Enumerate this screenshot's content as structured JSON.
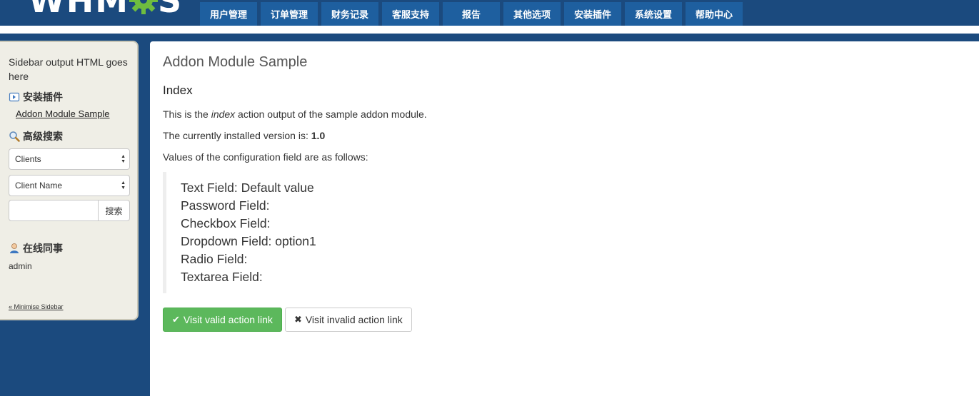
{
  "header": {
    "logo_left": "WHM",
    "logo_right": "S",
    "nav": [
      "用户管理",
      "订单管理",
      "财务记录",
      "客服支持",
      "报告",
      "其他选项",
      "安装插件",
      "系统设置",
      "帮助中心"
    ]
  },
  "sidebar": {
    "intro": "Sidebar output HTML goes here",
    "addons_heading": "安装插件",
    "addon_link": "Addon Module Sample",
    "search_heading": "高级搜索",
    "search_type": "Clients",
    "search_field": "Client Name",
    "search_value": "",
    "search_button": "搜索",
    "staff_heading": "在线同事",
    "staff_name": "admin",
    "minimise": "« Minimise Sidebar"
  },
  "content": {
    "title": "Addon Module Sample",
    "section": "Index",
    "para1_pre": "This is the ",
    "para1_em": "index",
    "para1_post": " action output of the sample addon module.",
    "para2_pre": "The currently installed version is: ",
    "para2_version": "1.0",
    "para3": "Values of the configuration field are as follows:",
    "fields": [
      "Text Field: Default value",
      "Password Field:",
      "Checkbox Field:",
      "Dropdown Field: option1",
      "Radio Field:",
      "Textarea Field:"
    ],
    "valid_button": "Visit valid action link",
    "invalid_button": "Visit invalid action link"
  },
  "colors": {
    "header_bg": "#1b4a7e",
    "nav_bg": "#1e5f9f",
    "logo_gear": "#6fbd3f",
    "success": "#5cb85c"
  },
  "icons": [
    "gear-icon",
    "addon-icon",
    "magnifier-icon",
    "user-icon",
    "check-icon",
    "x-icon",
    "select-arrows-icon"
  ]
}
